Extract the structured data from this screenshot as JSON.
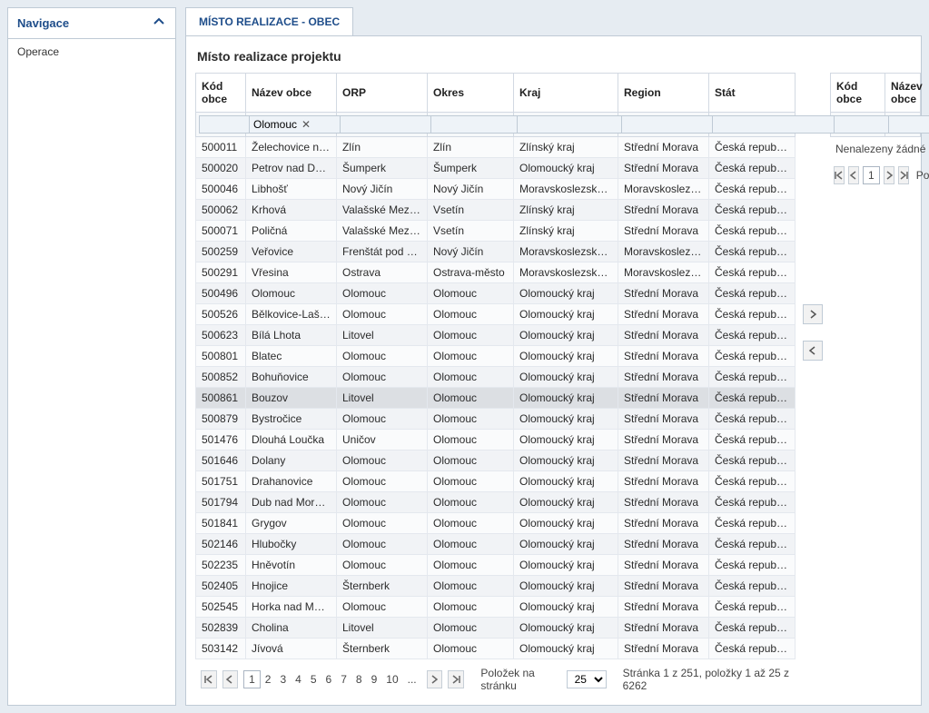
{
  "nav": {
    "header": "Navigace",
    "items": [
      "Operace"
    ]
  },
  "tab": {
    "label": "MÍSTO REALIZACE - OBEC"
  },
  "title": "Místo realizace projektu",
  "left_table": {
    "headers": [
      "Kód obce",
      "Název obce",
      "ORP",
      "Okres",
      "Kraj",
      "Region",
      "Stát"
    ],
    "filter_values": [
      "",
      "Olomouc",
      "",
      "",
      "",
      "",
      ""
    ],
    "selected_index": 13,
    "rows": [
      [
        "500011",
        "Želechovice nad...",
        "Zlín",
        "Zlín",
        "Zlínský kraj",
        "Střední Morava",
        "Česká republika"
      ],
      [
        "500020",
        "Petrov nad Desnou",
        "Šumperk",
        "Šumperk",
        "Olomoucký kraj",
        "Střední Morava",
        "Česká republika"
      ],
      [
        "500046",
        "Libhošť",
        "Nový Jičín",
        "Nový Jičín",
        "Moravskoslezský kraj",
        "Moravskoslezsko",
        "Česká republika"
      ],
      [
        "500062",
        "Krhová",
        "Valašské Meziříčí",
        "Vsetín",
        "Zlínský kraj",
        "Střední Morava",
        "Česká republika"
      ],
      [
        "500071",
        "Poličná",
        "Valašské Meziříčí",
        "Vsetín",
        "Zlínský kraj",
        "Střední Morava",
        "Česká republika"
      ],
      [
        "500259",
        "Veřovice",
        "Frenštát pod Rad...",
        "Nový Jičín",
        "Moravskoslezský kraj",
        "Moravskoslezsko",
        "Česká republika"
      ],
      [
        "500291",
        "Vřesina",
        "Ostrava",
        "Ostrava-město",
        "Moravskoslezský kraj",
        "Moravskoslezsko",
        "Česká republika"
      ],
      [
        "500496",
        "Olomouc",
        "Olomouc",
        "Olomouc",
        "Olomoucký kraj",
        "Střední Morava",
        "Česká republika"
      ],
      [
        "500526",
        "Bělkovice-Lašťany",
        "Olomouc",
        "Olomouc",
        "Olomoucký kraj",
        "Střední Morava",
        "Česká republika"
      ],
      [
        "500623",
        "Bílá Lhota",
        "Litovel",
        "Olomouc",
        "Olomoucký kraj",
        "Střední Morava",
        "Česká republika"
      ],
      [
        "500801",
        "Blatec",
        "Olomouc",
        "Olomouc",
        "Olomoucký kraj",
        "Střední Morava",
        "Česká republika"
      ],
      [
        "500852",
        "Bohuňovice",
        "Olomouc",
        "Olomouc",
        "Olomoucký kraj",
        "Střední Morava",
        "Česká republika"
      ],
      [
        "500861",
        "Bouzov",
        "Litovel",
        "Olomouc",
        "Olomoucký kraj",
        "Střední Morava",
        "Česká republika"
      ],
      [
        "500879",
        "Bystročice",
        "Olomouc",
        "Olomouc",
        "Olomoucký kraj",
        "Střední Morava",
        "Česká republika"
      ],
      [
        "501476",
        "Dlouhá Loučka",
        "Uničov",
        "Olomouc",
        "Olomoucký kraj",
        "Střední Morava",
        "Česká republika"
      ],
      [
        "501646",
        "Dolany",
        "Olomouc",
        "Olomouc",
        "Olomoucký kraj",
        "Střední Morava",
        "Česká republika"
      ],
      [
        "501751",
        "Drahanovice",
        "Olomouc",
        "Olomouc",
        "Olomoucký kraj",
        "Střední Morava",
        "Česká republika"
      ],
      [
        "501794",
        "Dub nad Moravou",
        "Olomouc",
        "Olomouc",
        "Olomoucký kraj",
        "Střední Morava",
        "Česká republika"
      ],
      [
        "501841",
        "Grygov",
        "Olomouc",
        "Olomouc",
        "Olomoucký kraj",
        "Střední Morava",
        "Česká republika"
      ],
      [
        "502146",
        "Hlubočky",
        "Olomouc",
        "Olomouc",
        "Olomoucký kraj",
        "Střední Morava",
        "Česká republika"
      ],
      [
        "502235",
        "Hněvotín",
        "Olomouc",
        "Olomouc",
        "Olomoucký kraj",
        "Střední Morava",
        "Česká republika"
      ],
      [
        "502405",
        "Hnojice",
        "Šternberk",
        "Olomouc",
        "Olomoucký kraj",
        "Střední Morava",
        "Česká republika"
      ],
      [
        "502545",
        "Horka nad Morav...",
        "Olomouc",
        "Olomouc",
        "Olomoucký kraj",
        "Střední Morava",
        "Česká republika"
      ],
      [
        "502839",
        "Cholina",
        "Litovel",
        "Olomouc",
        "Olomoucký kraj",
        "Střední Morava",
        "Česká republika"
      ],
      [
        "503142",
        "Jívová",
        "Šternberk",
        "Olomouc",
        "Olomoucký kraj",
        "Střední Morava",
        "Česká republika"
      ]
    ]
  },
  "right_table": {
    "headers": [
      "Kód obce",
      "Název obce"
    ],
    "empty_msg": "Nenalezeny žádné záznamy k zobraz"
  },
  "pager": {
    "current": 1,
    "pages": [
      "1",
      "2",
      "3",
      "4",
      "5",
      "6",
      "7",
      "8",
      "9",
      "10",
      "..."
    ],
    "per_page_label": "Položek na stránku",
    "per_page_value": "25",
    "status": "Stránka 1 z 251, položky 1 až 25 z 6262"
  },
  "pager_right": {
    "current": 1,
    "label": "Polož"
  }
}
